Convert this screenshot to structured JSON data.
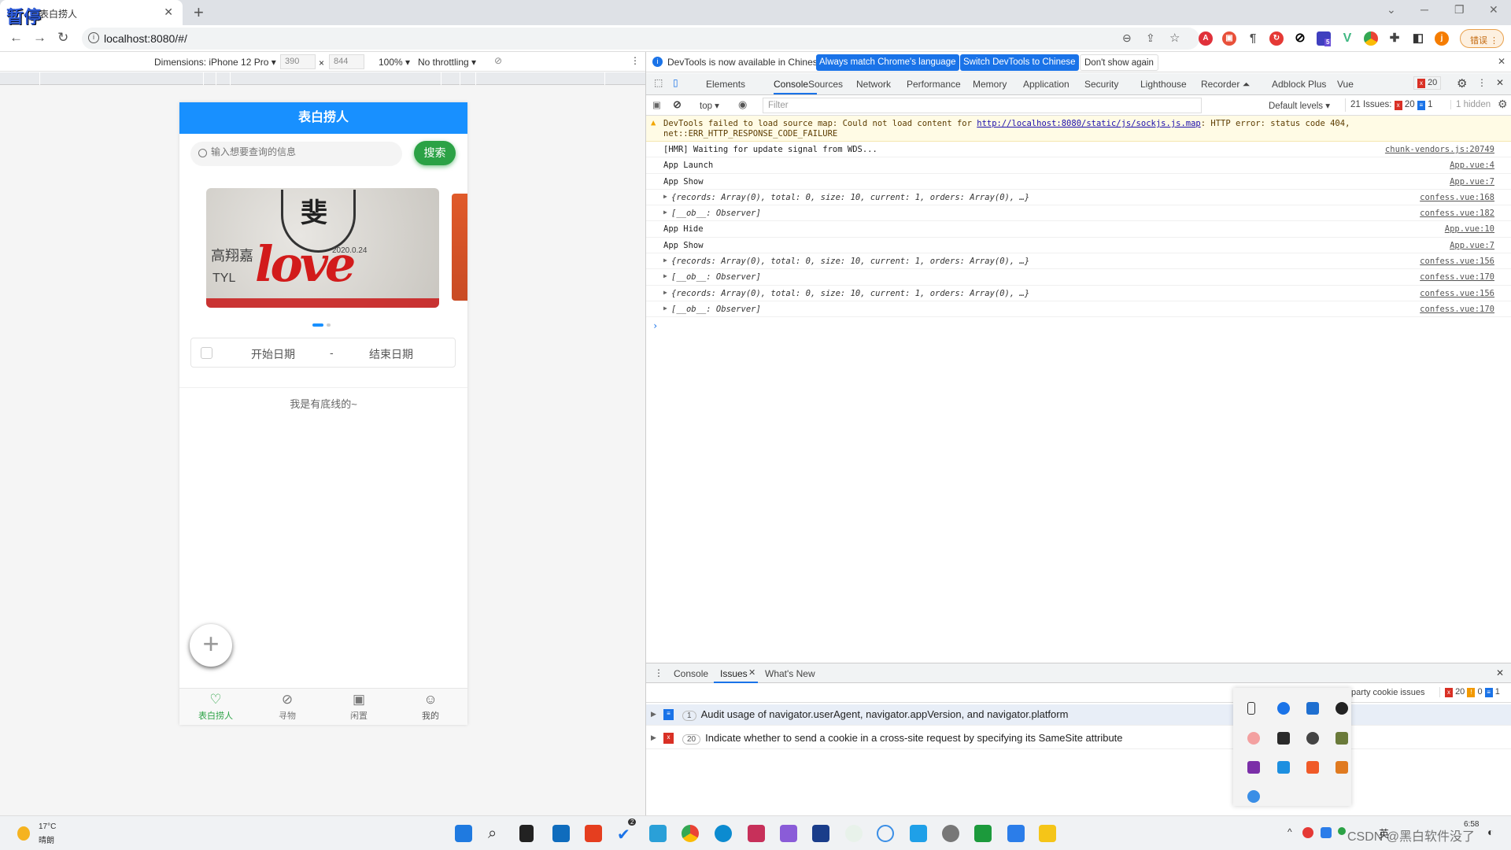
{
  "browser": {
    "tab_title": "表白捞人",
    "pause_overlay": "暂停",
    "url": "localhost:8080/#/",
    "error_button": "错误",
    "extension_badge": "5"
  },
  "device_toolbar": {
    "dimensions_label": "Dimensions: iPhone 12 Pro ▾",
    "width": "390",
    "height": "844",
    "times": "×",
    "zoom": "100% ▾",
    "throttling": "No throttling ▾"
  },
  "mobile": {
    "header_title": "表白捞人",
    "search_placeholder": "输入想要查询的信息",
    "search_button": "搜索",
    "banner": {
      "top_char": "斐",
      "word": "love",
      "scribble_1": "高翔嘉",
      "scribble_2": "2020.0.24",
      "scribble_3": "TYL"
    },
    "carousel_count": 2,
    "carousel_active": 1,
    "start_date": "开始日期",
    "date_separator": "-",
    "end_date": "结束日期",
    "end_text": "我是有底线的~",
    "fab": "+",
    "tabbar": [
      {
        "label": "表白捞人",
        "icon": "heart-icon",
        "active": true
      },
      {
        "label": "寻物",
        "icon": "compass-icon",
        "active": false
      },
      {
        "label": "闲置",
        "icon": "box-icon",
        "active": false
      },
      {
        "label": "我的",
        "icon": "face-icon",
        "active": false
      }
    ],
    "active_color": "#2ba245",
    "header_color": "#1890ff"
  },
  "devtools": {
    "info": {
      "text": "DevTools is now available in Chinese!",
      "btn_match": "Always match Chrome's language",
      "btn_switch": "Switch DevTools to Chinese",
      "btn_dismiss": "Don't show again"
    },
    "tabs": [
      "Elements",
      "Console",
      "Sources",
      "Network",
      "Performance",
      "Memory",
      "Application",
      "Security",
      "Lighthouse",
      "Recorder ⏶",
      "Adblock Plus",
      "Vue"
    ],
    "active_tab": "Console",
    "error_count": "20",
    "console_toolbar": {
      "context": "top ▾",
      "filter_placeholder": "Filter",
      "levels": "Default levels ▾",
      "issues_label": "21 Issues:",
      "issues_errors": "20",
      "issues_info": "1",
      "hidden": "1 hidden"
    },
    "warning": {
      "prefix": "DevTools failed to load source map: Could not load content for ",
      "link": "http://localhost:8080/static/js/sockjs.js.map",
      "suffix": ": HTTP error: status code 404, net::ERR_HTTP_RESPONSE_CODE_FAILURE"
    },
    "logs": [
      {
        "text": "[HMR] Waiting for update signal from WDS...",
        "src": "chunk-vendors.js:20749",
        "obj": false
      },
      {
        "text": "App Launch",
        "src": "App.vue:4",
        "obj": false
      },
      {
        "text": "App Show",
        "src": "App.vue:7",
        "obj": false
      },
      {
        "text": "{records: Array(0), total: 0, size: 10, current: 1, orders: Array(0), …}",
        "src": "confess.vue:168",
        "obj": true
      },
      {
        "text": "[__ob__: Observer]",
        "src": "confess.vue:182",
        "obj": true
      },
      {
        "text": "App Hide",
        "src": "App.vue:10",
        "obj": false
      },
      {
        "text": "App Show",
        "src": "App.vue:7",
        "obj": false
      },
      {
        "text": "{records: Array(0), total: 0, size: 10, current: 1, orders: Array(0), …}",
        "src": "confess.vue:156",
        "obj": true
      },
      {
        "text": "[__ob__: Observer]",
        "src": "confess.vue:170",
        "obj": true
      },
      {
        "text": "{records: Array(0), total: 0, size: 10, current: 1, orders: Array(0), …}",
        "src": "confess.vue:156",
        "obj": true
      },
      {
        "text": "[__ob__: Observer]",
        "src": "confess.vue:170",
        "obj": true
      }
    ],
    "drawer": {
      "tabs": [
        "Console",
        "Issues",
        "What's New"
      ],
      "active_tab": "Issues",
      "toolbar_text": "party cookie issues",
      "counts": {
        "errors": "20",
        "warnings": "0",
        "info": "1"
      },
      "issues": [
        {
          "count": "1",
          "text": "Audit usage of navigator.userAgent, navigator.appVersion, and navigator.platform",
          "kind": "info"
        },
        {
          "count": "20",
          "text": "Indicate whether to send a cookie in a cross-site request by specifying its SameSite attribute",
          "kind": "error"
        }
      ]
    }
  },
  "taskbar": {
    "weather_temp": "17°C",
    "weather_desc": "晴朗",
    "todo_badge": "2",
    "time": "6:58",
    "watermark": "CSDN @黑白软件没了",
    "ime": "英"
  }
}
